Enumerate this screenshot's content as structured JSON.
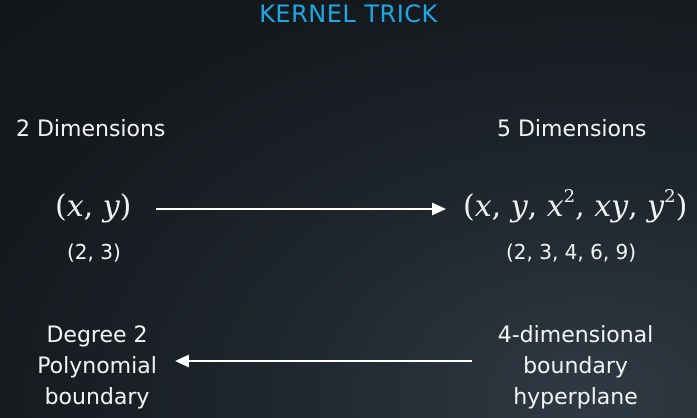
{
  "title": "KERNEL TRICK",
  "left": {
    "heading": "2 Dimensions",
    "vector": {
      "open": "(",
      "vars": [
        "x",
        "y"
      ],
      "close": ")"
    },
    "example": "(2, 3)"
  },
  "right": {
    "heading": "5 Dimensions",
    "vector": {
      "open": "(",
      "x": "x",
      "y": "y",
      "x2_base": "x",
      "x2_exp": "2",
      "xy": "xy",
      "y2_base": "y",
      "y2_exp": "2",
      "close": ")"
    },
    "example": "(2, 3, 4, 6, 9)"
  },
  "bottom_left": [
    "Degree 2",
    "Polynomial",
    "boundary"
  ],
  "bottom_right": [
    "4-dimensional",
    "boundary",
    "hyperplane"
  ],
  "colors": {
    "title": "#1ea7e1",
    "text": "#f2f2f2",
    "arrow": "#ffffff",
    "background": "#15191e"
  }
}
